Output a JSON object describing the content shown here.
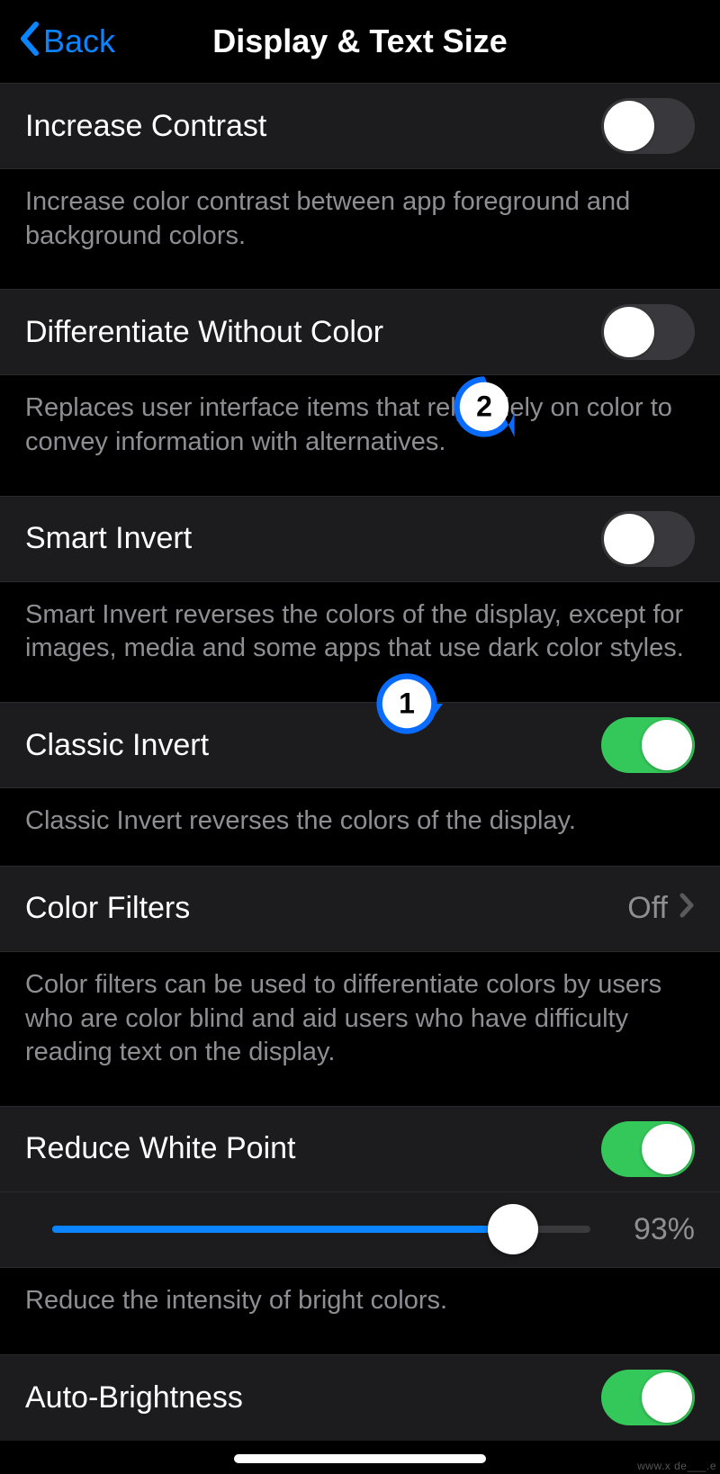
{
  "nav": {
    "back_label": "Back",
    "title": "Display & Text Size"
  },
  "sections": {
    "increase_contrast": {
      "label": "Increase Contrast",
      "on": false,
      "footer": "Increase color contrast between app foreground and background colors."
    },
    "diff_without_color": {
      "label": "Differentiate Without Color",
      "on": false,
      "footer": "Replaces user interface items that rely solely on color to convey information with alternatives."
    },
    "smart_invert": {
      "label": "Smart Invert",
      "on": false,
      "footer": "Smart Invert reverses the colors of the display, except for images, media and some apps that use dark color styles."
    },
    "classic_invert": {
      "label": "Classic Invert",
      "on": true,
      "footer": "Classic Invert reverses the colors of the display."
    },
    "color_filters": {
      "label": "Color Filters",
      "value": "Off",
      "footer": "Color filters can be used to differentiate colors by users who are color blind and aid users who have difficulty reading text on the display."
    },
    "reduce_white_point": {
      "label": "Reduce White Point",
      "on": true,
      "percent_display": "93%",
      "percent": 93,
      "footer": "Reduce the intensity of bright colors."
    },
    "auto_brightness": {
      "label": "Auto-Brightness",
      "on": true
    }
  },
  "annotations": {
    "pin1": "1",
    "pin2": "2"
  },
  "colors": {
    "accent_blue": "#0a84ff",
    "toggle_green": "#34c759",
    "row_bg": "#1c1c1e",
    "secondary_text": "#8e8e93"
  },
  "watermark": "www.x de___.e"
}
